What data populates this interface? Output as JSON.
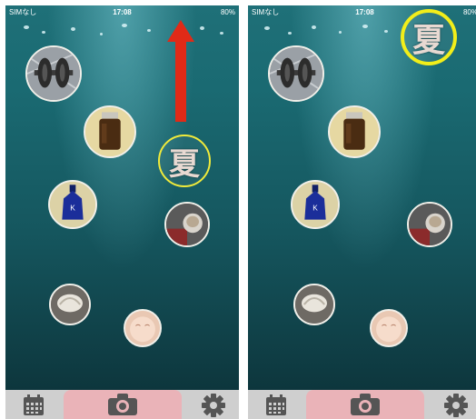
{
  "screens": [
    {
      "status": {
        "carrier": "SIMなし",
        "wifi": "wifi-icon",
        "time": "17:08",
        "battery": "80%"
      },
      "items": [
        {
          "name": "dumbbell-item",
          "icon": "dumbbell"
        },
        {
          "name": "brown-jar-item",
          "icon": "brown-jar"
        },
        {
          "name": "blue-bottle-item",
          "icon": "blue-bottle"
        },
        {
          "name": "cup-item",
          "icon": "cup"
        },
        {
          "name": "napkin-item",
          "icon": "napkin"
        },
        {
          "name": "smile-ball-item",
          "icon": "smile-ball"
        }
      ],
      "kanji": "夏",
      "arrow": {
        "color": "#e02a17",
        "direction": "up"
      },
      "tabs": {
        "calendar": "calendar-icon",
        "camera": "camera-icon",
        "settings": "gear-icon"
      }
    },
    {
      "status": {
        "carrier": "SIMなし",
        "wifi": "wifi-icon",
        "time": "17:08",
        "battery": "80%"
      },
      "items": [
        {
          "name": "dumbbell-item",
          "icon": "dumbbell"
        },
        {
          "name": "brown-jar-item",
          "icon": "brown-jar"
        },
        {
          "name": "blue-bottle-item",
          "icon": "blue-bottle"
        },
        {
          "name": "cup-item",
          "icon": "cup"
        },
        {
          "name": "napkin-item",
          "icon": "napkin"
        },
        {
          "name": "smile-ball-item",
          "icon": "smile-ball"
        }
      ],
      "kanji": "夏",
      "highlight_color": "#f2ee1a",
      "tabs": {
        "calendar": "calendar-icon",
        "camera": "camera-icon",
        "settings": "gear-icon"
      }
    }
  ]
}
